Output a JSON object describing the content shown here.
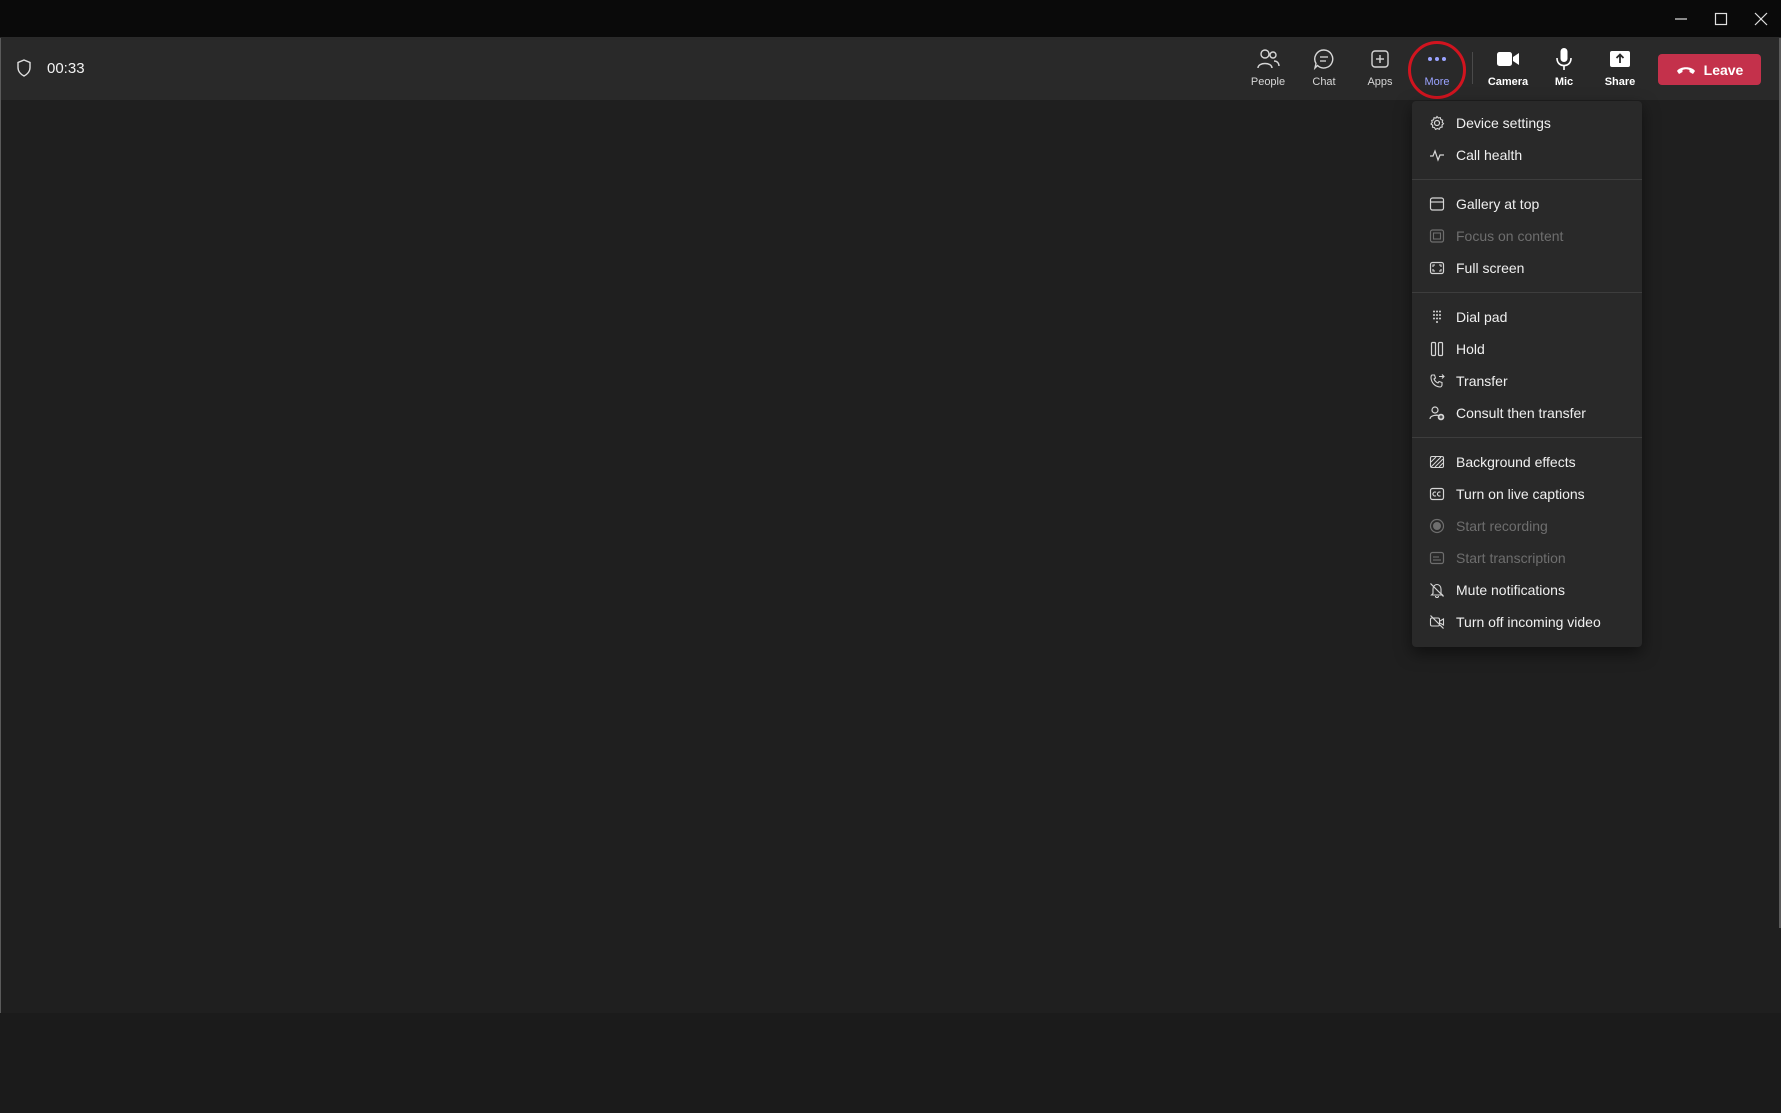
{
  "window": {
    "controls": [
      "minimize",
      "maximize",
      "close"
    ]
  },
  "call": {
    "timer": "00:33"
  },
  "toolbar": {
    "buttons": {
      "people": "People",
      "chat": "Chat",
      "apps": "Apps",
      "more": "More",
      "camera": "Camera",
      "mic": "Mic",
      "share": "Share"
    },
    "leave": "Leave",
    "colors": {
      "leave": "#c4314b",
      "more_highlight": "#9aa3ff",
      "annotation_circle": "#d1141f"
    }
  },
  "menu": {
    "groups": [
      [
        {
          "label": "Device settings",
          "icon": "gear-icon",
          "enabled": true
        },
        {
          "label": "Call health",
          "icon": "pulse-icon",
          "enabled": true
        }
      ],
      [
        {
          "label": "Gallery at top",
          "icon": "gallery-icon",
          "enabled": true
        },
        {
          "label": "Focus on content",
          "icon": "focus-icon",
          "enabled": false
        },
        {
          "label": "Full screen",
          "icon": "fullscreen-icon",
          "enabled": true
        }
      ],
      [
        {
          "label": "Dial pad",
          "icon": "dialpad-icon",
          "enabled": true
        },
        {
          "label": "Hold",
          "icon": "pause-icon",
          "enabled": true
        },
        {
          "label": "Transfer",
          "icon": "transfer-icon",
          "enabled": true
        },
        {
          "label": "Consult then transfer",
          "icon": "consult-icon",
          "enabled": true
        }
      ],
      [
        {
          "label": "Background effects",
          "icon": "background-icon",
          "enabled": true
        },
        {
          "label": "Turn on live captions",
          "icon": "captions-icon",
          "enabled": true
        },
        {
          "label": "Start recording",
          "icon": "record-icon",
          "enabled": false
        },
        {
          "label": "Start transcription",
          "icon": "transcript-icon",
          "enabled": false
        },
        {
          "label": "Mute notifications",
          "icon": "bell-off-icon",
          "enabled": true
        },
        {
          "label": "Turn off incoming video",
          "icon": "video-off-icon",
          "enabled": true
        }
      ]
    ]
  }
}
